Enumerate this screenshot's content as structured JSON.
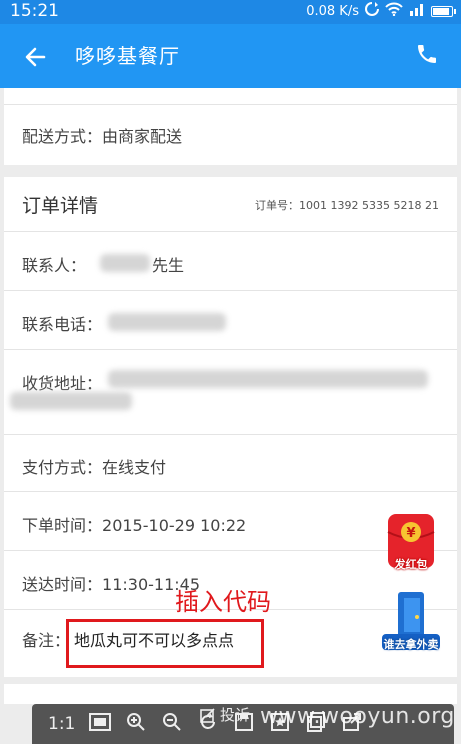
{
  "status_bar": {
    "time": "15:21",
    "speed": "0.08 K/s"
  },
  "app_bar": {
    "title": "哆哆基餐厅",
    "back_icon": "arrow-left-icon",
    "phone_icon": "phone-icon"
  },
  "delivery": {
    "label": "配送方式：",
    "value": "由商家配送"
  },
  "order": {
    "title": "订单详情",
    "number_label": "订单号：",
    "number_value": "1001 1392 5335 5218 21",
    "contact_label": "联系人：",
    "contact_suffix": "先生",
    "phone_label": "联系电话：",
    "address_label": "收货地址：",
    "payment_label": "支付方式：",
    "payment_value": "在线支付",
    "order_time_label": "下单时间：",
    "order_time_value": "2015-10-29 10:22",
    "delivery_time_label": "送达时间：",
    "delivery_time_value": "11:30-11:45",
    "note_label": "备注：",
    "note_value": "地瓜丸可不可以多点点"
  },
  "annotation": {
    "text": "插入代码"
  },
  "floating": {
    "red_packet_label": "发红包",
    "takeout_label": "谁去拿外卖"
  },
  "viewer_toolbar": {
    "ratio": "1:1",
    "complain": "投诉"
  },
  "watermark": "www.wooyun.org",
  "colors": {
    "primary": "#2196f3",
    "status_bar": "#1e88e5",
    "highlight": "#e0191d"
  }
}
